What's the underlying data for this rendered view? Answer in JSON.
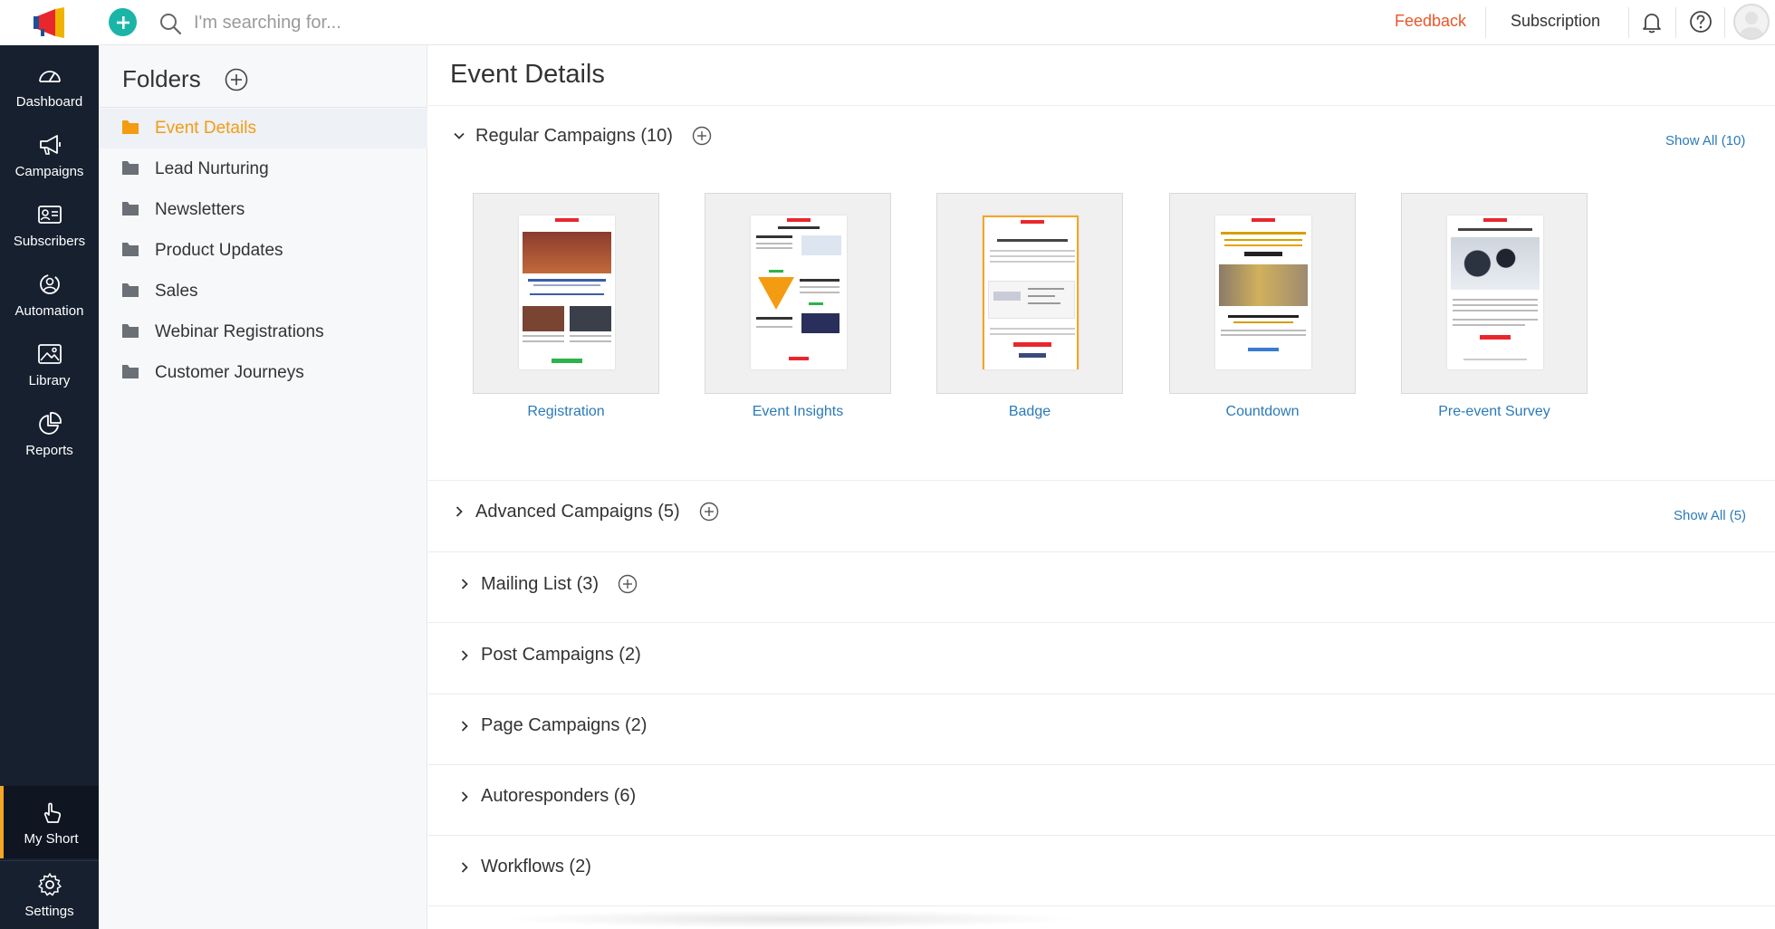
{
  "header": {
    "search_placeholder": "I'm searching for...",
    "feedback_label": "Feedback",
    "subscription_label": "Subscription"
  },
  "nav": {
    "items": [
      {
        "label": "Dashboard",
        "icon": "dashboard-icon"
      },
      {
        "label": "Campaigns",
        "icon": "megaphone-icon"
      },
      {
        "label": "Subscribers",
        "icon": "contact-card-icon"
      },
      {
        "label": "Automation",
        "icon": "automation-icon"
      },
      {
        "label": "Library",
        "icon": "image-icon"
      },
      {
        "label": "Reports",
        "icon": "pie-chart-icon"
      }
    ],
    "my_short_label": "My Short",
    "settings_label": "Settings"
  },
  "folders": {
    "title": "Folders",
    "items": [
      {
        "label": "Event Details",
        "active": true
      },
      {
        "label": "Lead Nurturing"
      },
      {
        "label": "Newsletters"
      },
      {
        "label": "Product Updates"
      },
      {
        "label": "Sales"
      },
      {
        "label": "Webinar Registrations"
      },
      {
        "label": "Customer Journeys"
      }
    ]
  },
  "main": {
    "title": "Event Details",
    "regular": {
      "label": "Regular Campaigns (10)",
      "show_all": "Show All (10)",
      "cards": [
        {
          "label": "Registration"
        },
        {
          "label": "Event Insights"
        },
        {
          "label": "Badge"
        },
        {
          "label": "Countdown"
        },
        {
          "label": "Pre-event Survey"
        }
      ]
    },
    "sections": [
      {
        "label": "Advanced Campaigns (5)",
        "show_all": "Show All (5)"
      },
      {
        "label": "Mailing List (3)"
      },
      {
        "label": "Post Campaigns (2)"
      },
      {
        "label": "Page Campaigns (2)"
      },
      {
        "label": "Autoresponders (6)"
      },
      {
        "label": "Workflows (2)"
      }
    ]
  },
  "colors": {
    "nav_bg": "#17202f",
    "accent_orange": "#f39c12",
    "feedback_red": "#e8572a",
    "link_blue": "#2a7ab8",
    "add_teal": "#1bb5a8"
  }
}
